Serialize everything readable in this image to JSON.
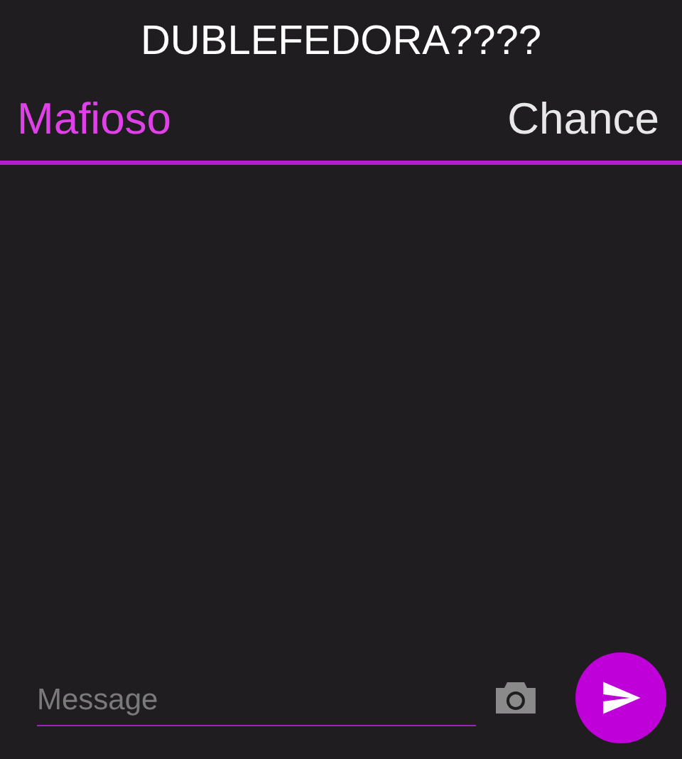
{
  "title": "DUBLEFEDORA????",
  "tabs": [
    {
      "label": "Mafioso",
      "selected": true
    },
    {
      "label": "Chance",
      "selected": false
    }
  ],
  "composer": {
    "placeholder": "Message"
  }
}
